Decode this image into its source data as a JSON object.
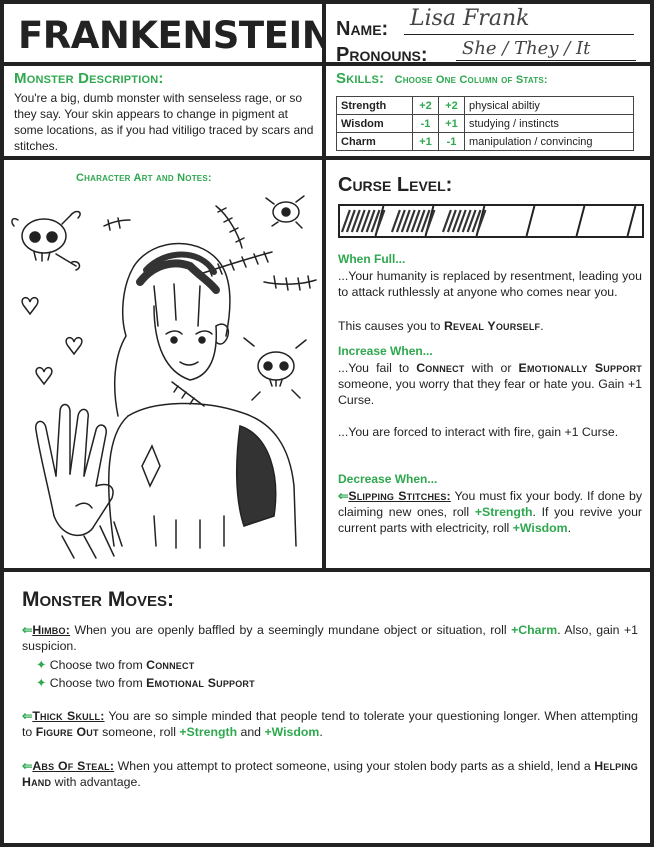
{
  "title": "FRANKENSTEIN",
  "identity": {
    "name_label": "Name:",
    "name_value": "Lisa Frank",
    "pronouns_label": "Pronouns:",
    "pronouns_value": "She / They / It"
  },
  "description": {
    "heading": "Monster Description:",
    "text": "You're a big, dumb monster with senseless rage, or so they say. Your skin appears to change in pigment at some locations, as if you had vitiligo traced by scars and stitches."
  },
  "skills": {
    "heading": "Skills:",
    "subheading": "Choose One Column of Stats:",
    "rows": [
      {
        "stat": "Strength",
        "a": "+2",
        "b": "+2",
        "desc": "physical abiltiy"
      },
      {
        "stat": "Wisdom",
        "a": "-1",
        "b": "+1",
        "desc": "studying / instincts"
      },
      {
        "stat": "Charm",
        "a": "+1",
        "b": "-1",
        "desc": "manipulation / convincing"
      }
    ]
  },
  "art": {
    "heading": "Character Art and Notes:"
  },
  "curse": {
    "heading": "Curse Level:",
    "filled": 3,
    "total": 6,
    "when_full_heading": "When Full...",
    "when_full_text": "...Your humanity is replaced by resentment, leading you to attack ruthlessly at anyone who comes near you.",
    "when_full_text2_pre": "This causes you to ",
    "when_full_text2_move": "Reveal Yourself",
    "when_full_text2_post": ".",
    "increase_heading": "Increase When...",
    "increase_1_pre": "...You fail to ",
    "increase_1_move1": "Connect",
    "increase_1_mid": " with or ",
    "increase_1_move2": "Emotionally Support",
    "increase_1_post": " someone, you worry that they fear or hate you. Gain +1 Curse.",
    "increase_2": "...You are forced to interact with fire, gain +1 Curse.",
    "decrease_heading": "Decrease When...",
    "decrease_arrow": "⇐",
    "decrease_move": "Slipping Stitches:",
    "decrease_pre": " You must fix your body. If done by claiming new ones, roll ",
    "decrease_stat1": "+Strength",
    "decrease_mid": ". If you revive your current parts with electricity, roll ",
    "decrease_stat2": "+Wisdom",
    "decrease_post": "."
  },
  "moves": {
    "heading": "Monster Moves:",
    "arrow": "⇐",
    "himbo_name": "Himbo:",
    "himbo_pre": " When you are openly baffled by a seemingly mundane object or situation, roll ",
    "himbo_stat": "+Charm",
    "himbo_post": ". Also, gain +1 suspicion.",
    "himbo_bullet": "✦",
    "himbo_opt_prefix": "Choose two from ",
    "himbo_opt1": "Connect",
    "himbo_opt2": "Emotional Support",
    "thick_name": "Thick Skull:",
    "thick_pre": " You are so simple minded that people tend to tolerate your questioning longer. When attempting to ",
    "thick_move": "Figure Out",
    "thick_mid": " someone, roll ",
    "thick_stat1": "+Strength",
    "thick_and": " and ",
    "thick_stat2": "+Wisdom",
    "thick_post": ".",
    "abs_name": "Abs Of Steal:",
    "abs_pre": " When you attempt to protect someone, using your stolen body parts as a shield, lend a ",
    "abs_move": "Helping Hand",
    "abs_post": " with advantage."
  },
  "colors": {
    "accent": "#2fa84f",
    "ink": "#222222"
  }
}
